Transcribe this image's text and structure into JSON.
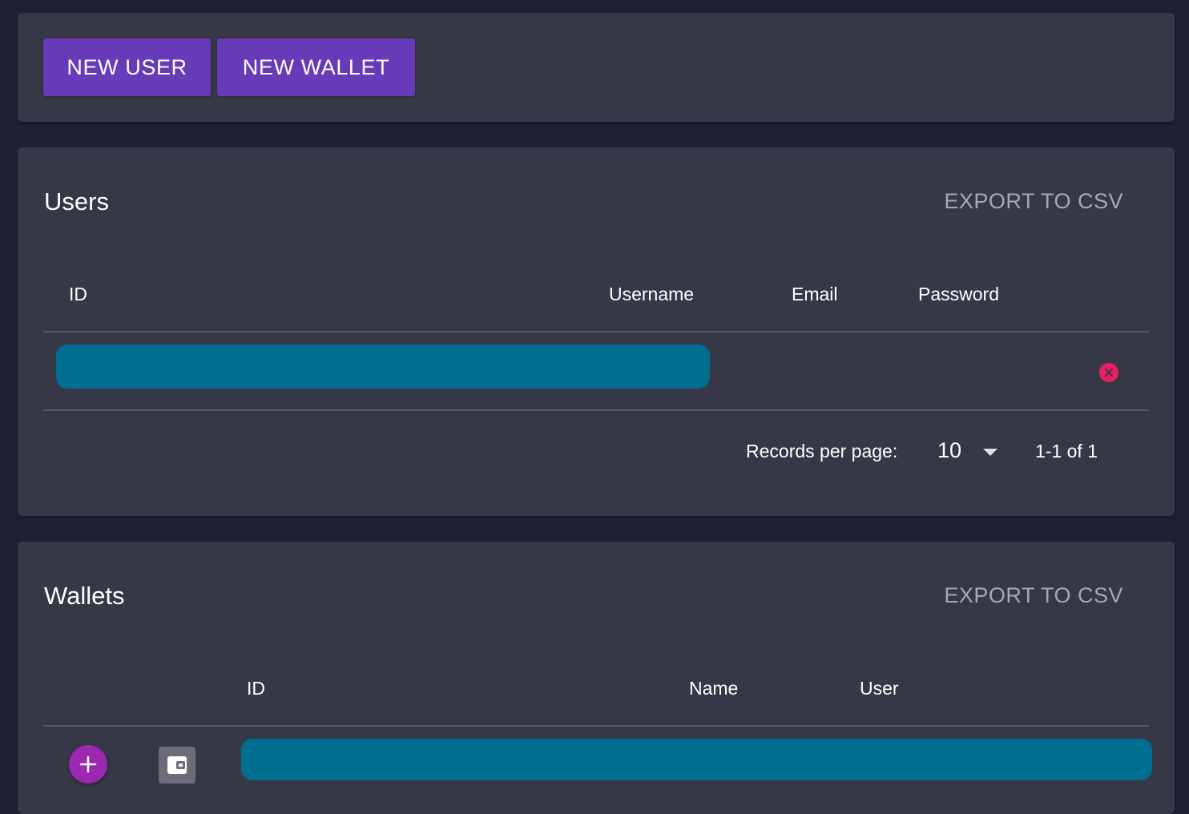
{
  "toolbar": {
    "new_user_label": "NEW USER",
    "new_wallet_label": "NEW WALLET"
  },
  "users": {
    "title": "Users",
    "export_label": "EXPORT TO CSV",
    "columns": [
      "ID",
      "Username",
      "Email",
      "Password"
    ],
    "pagination": {
      "records_per_page_label": "Records per page:",
      "records_per_page_value": "10",
      "range_text": "1-1 of 1"
    }
  },
  "wallets": {
    "title": "Wallets",
    "export_label": "EXPORT TO CSV",
    "columns": [
      "ID",
      "Name",
      "User"
    ]
  },
  "colors": {
    "accent": "#673ab7",
    "fab": "#9c27b0",
    "teal": "#006f8f",
    "delete": "#e91e63",
    "card": "#363848",
    "background": "#1f2033"
  },
  "icons": {
    "delete": "close-circle-icon",
    "add": "plus-icon",
    "wallet": "wallet-icon"
  }
}
